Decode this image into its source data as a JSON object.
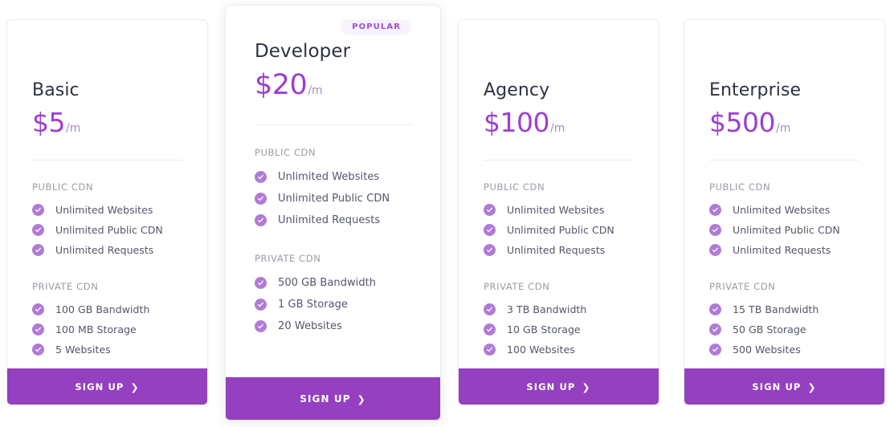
{
  "theme": {
    "accent": "#9440c0",
    "price_color": "#9c3fd0",
    "check_color": "#b07bd6",
    "badge_bg": "#f7f2fb",
    "badge_text": "#9b4fd1",
    "card_bg": "#ffffff",
    "page_bg": "#ffffff"
  },
  "signup_label": "SIGN UP",
  "chevron_glyph": "❯",
  "check_glyph": "check-mark",
  "plans": [
    {
      "name": "Basic",
      "price": "$5",
      "period": "/m",
      "featured": false,
      "badge": null,
      "sections": [
        {
          "label": "PUBLIC CDN",
          "features": [
            "Unlimited Websites",
            "Unlimited Public CDN",
            "Unlimited Requests"
          ]
        },
        {
          "label": "PRIVATE CDN",
          "features": [
            "100 GB Bandwidth",
            "100 MB Storage",
            "5 Websites"
          ]
        }
      ],
      "cta": "SIGN UP"
    },
    {
      "name": "Developer",
      "price": "$20",
      "period": "/m",
      "featured": true,
      "badge": "POPULAR",
      "sections": [
        {
          "label": "PUBLIC CDN",
          "features": [
            "Unlimited Websites",
            "Unlimited Public CDN",
            "Unlimited Requests"
          ]
        },
        {
          "label": "PRIVATE CDN",
          "features": [
            "500 GB Bandwidth",
            "1 GB Storage",
            "20 Websites"
          ]
        }
      ],
      "cta": "SIGN UP"
    },
    {
      "name": "Agency",
      "price": "$100",
      "period": "/m",
      "featured": false,
      "badge": null,
      "sections": [
        {
          "label": "PUBLIC CDN",
          "features": [
            "Unlimited Websites",
            "Unlimited Public CDN",
            "Unlimited Requests"
          ]
        },
        {
          "label": "PRIVATE CDN",
          "features": [
            "3 TB Bandwidth",
            "10 GB Storage",
            "100 Websites"
          ]
        }
      ],
      "cta": "SIGN UP"
    },
    {
      "name": "Enterprise",
      "price": "$500",
      "period": "/m",
      "featured": false,
      "badge": null,
      "sections": [
        {
          "label": "PUBLIC CDN",
          "features": [
            "Unlimited Websites",
            "Unlimited Public CDN",
            "Unlimited Requests"
          ]
        },
        {
          "label": "PRIVATE CDN",
          "features": [
            "15 TB Bandwidth",
            "50 GB Storage",
            "500 Websites"
          ]
        }
      ],
      "cta": "SIGN UP"
    }
  ]
}
